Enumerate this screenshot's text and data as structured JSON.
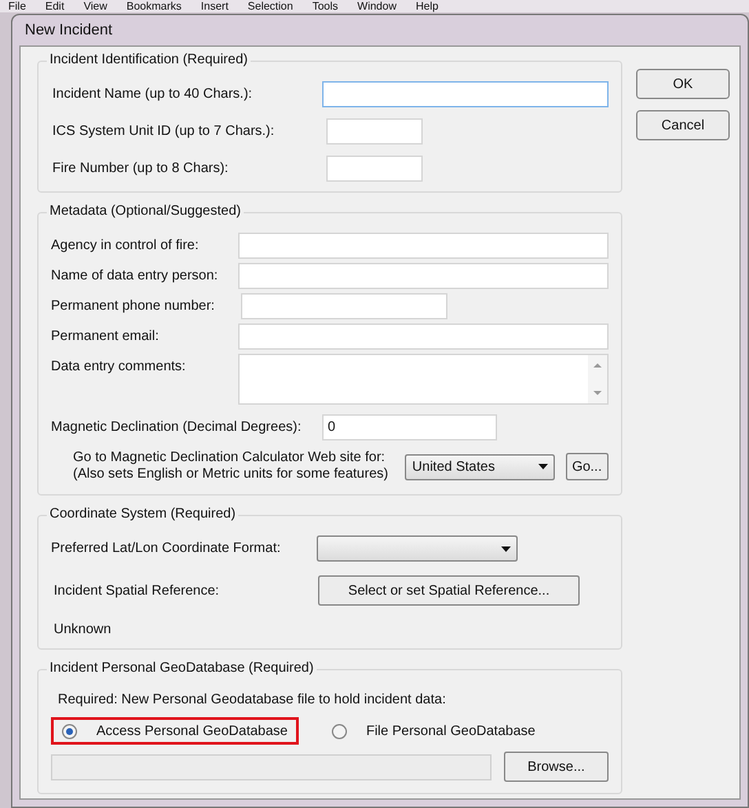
{
  "app_menu": [
    "File",
    "Edit",
    "View",
    "Bookmarks",
    "Insert",
    "Selection",
    "Tools",
    "Window",
    "Help"
  ],
  "window": {
    "title": "New Incident"
  },
  "buttons": [
    "OK",
    "Cancel"
  ],
  "identification": {
    "title": "Incident Identification (Required)",
    "fields": [
      {
        "label": "Incident Name (up to 40 Chars.):",
        "kind": "long",
        "focused": true
      },
      {
        "label": "ICS System Unit ID (up to 7 Chars.):",
        "kind": "short",
        "focused": false
      },
      {
        "label": "Fire Number (up to 8 Chars):",
        "kind": "short",
        "focused": false
      }
    ]
  },
  "metadata": {
    "title": "Metadata (Optional/Suggested)",
    "fields": [
      {
        "label": "Agency in control of fire:",
        "kind": "long"
      },
      {
        "label": "Name of data entry person:",
        "kind": "long"
      },
      {
        "label": "Permanent phone number:",
        "kind": "medium"
      },
      {
        "label": "Permanent email:",
        "kind": "long"
      },
      {
        "label": "Data entry comments:",
        "kind": "multiline"
      }
    ],
    "declination_label": "Magnetic Declination (Decimal Degrees):",
    "declination_value": "0",
    "calculator_label": "Go to Magnetic Declination Calculator Web site for:",
    "calculator_note": "(Also sets English or Metric units for some features)",
    "country": "United States",
    "go_button": "Go..."
  },
  "coordinates": {
    "title": "Coordinate System (Required)",
    "format_label": "Preferred Lat/Lon Coordinate Format:",
    "reference_label": "Incident Spatial Reference:",
    "reference_button": "Select or set Spatial Reference...",
    "reference_value": "Unknown"
  },
  "geodatabase": {
    "title": "Incident Personal GeoDatabase (Required)",
    "note": "Required: New Personal Geodatabase file to hold incident data:",
    "options": [
      {
        "label": "Access Personal GeoDatabase",
        "selected": true,
        "highlighted": true
      },
      {
        "label": "File Personal GeoDatabase",
        "selected": false,
        "highlighted": false
      }
    ],
    "browse_button": "Browse..."
  }
}
